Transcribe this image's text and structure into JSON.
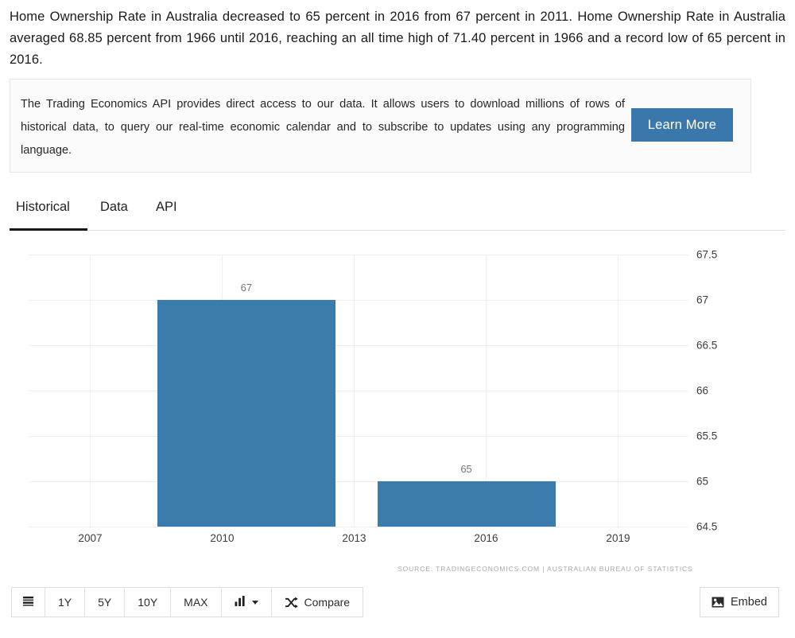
{
  "intro": {
    "paragraph": "Home Ownership Rate in Australia decreased to 65 percent in 2016 from 67 percent in 2011. Home Ownership Rate in Australia averaged 68.85 percent from 1966 until 2016, reaching an all time high of 71.40 percent in 1966 and a record low of 65 percent in 2016."
  },
  "api_banner": {
    "text": "The Trading Economics API provides direct access to our data. It allows users to download millions of rows of historical data, to query our real-time economic calendar and to subscribe to updates using any programming language.",
    "button_label": "Learn More",
    "button_color": "#3a78ab"
  },
  "tabs": {
    "items": [
      {
        "label": "Historical",
        "active": true
      },
      {
        "label": "Data",
        "active": false
      },
      {
        "label": "API",
        "active": false
      }
    ]
  },
  "chart_data": {
    "type": "bar",
    "title": "",
    "xlabel": "",
    "ylabel": "",
    "categories": [
      "2011",
      "2016"
    ],
    "values": [
      67,
      65
    ],
    "data_labels": [
      "67",
      "65"
    ],
    "bar_color": "#3b7cad",
    "ylim": [
      64.5,
      67.5
    ],
    "yticks": [
      "67.5",
      "67",
      "66.5",
      "66",
      "65.5",
      "65",
      "64.5"
    ],
    "ytick_values": [
      67.5,
      67,
      66.5,
      66,
      65.5,
      65,
      64.5
    ],
    "xticks": [
      "2007",
      "2010",
      "2013",
      "2016",
      "2019"
    ],
    "xtick_values": [
      2007,
      2010,
      2013,
      2016,
      2019
    ],
    "xlim": [
      2005.6,
      2020.6
    ],
    "grid": true,
    "legend": "none",
    "source": "SOURCE: TRADINGECONOMICS.COM | AUSTRALIAN BUREAU OF STATISTICS"
  },
  "toolbar": {
    "menu_icon": "list-icon",
    "ranges": [
      "1Y",
      "5Y",
      "10Y",
      "MAX"
    ],
    "chart_type_icon": "bar-chart-icon",
    "compare_label": "Compare",
    "compare_icon": "shuffle-icon",
    "embed_label": "Embed",
    "embed_icon": "image-icon"
  }
}
